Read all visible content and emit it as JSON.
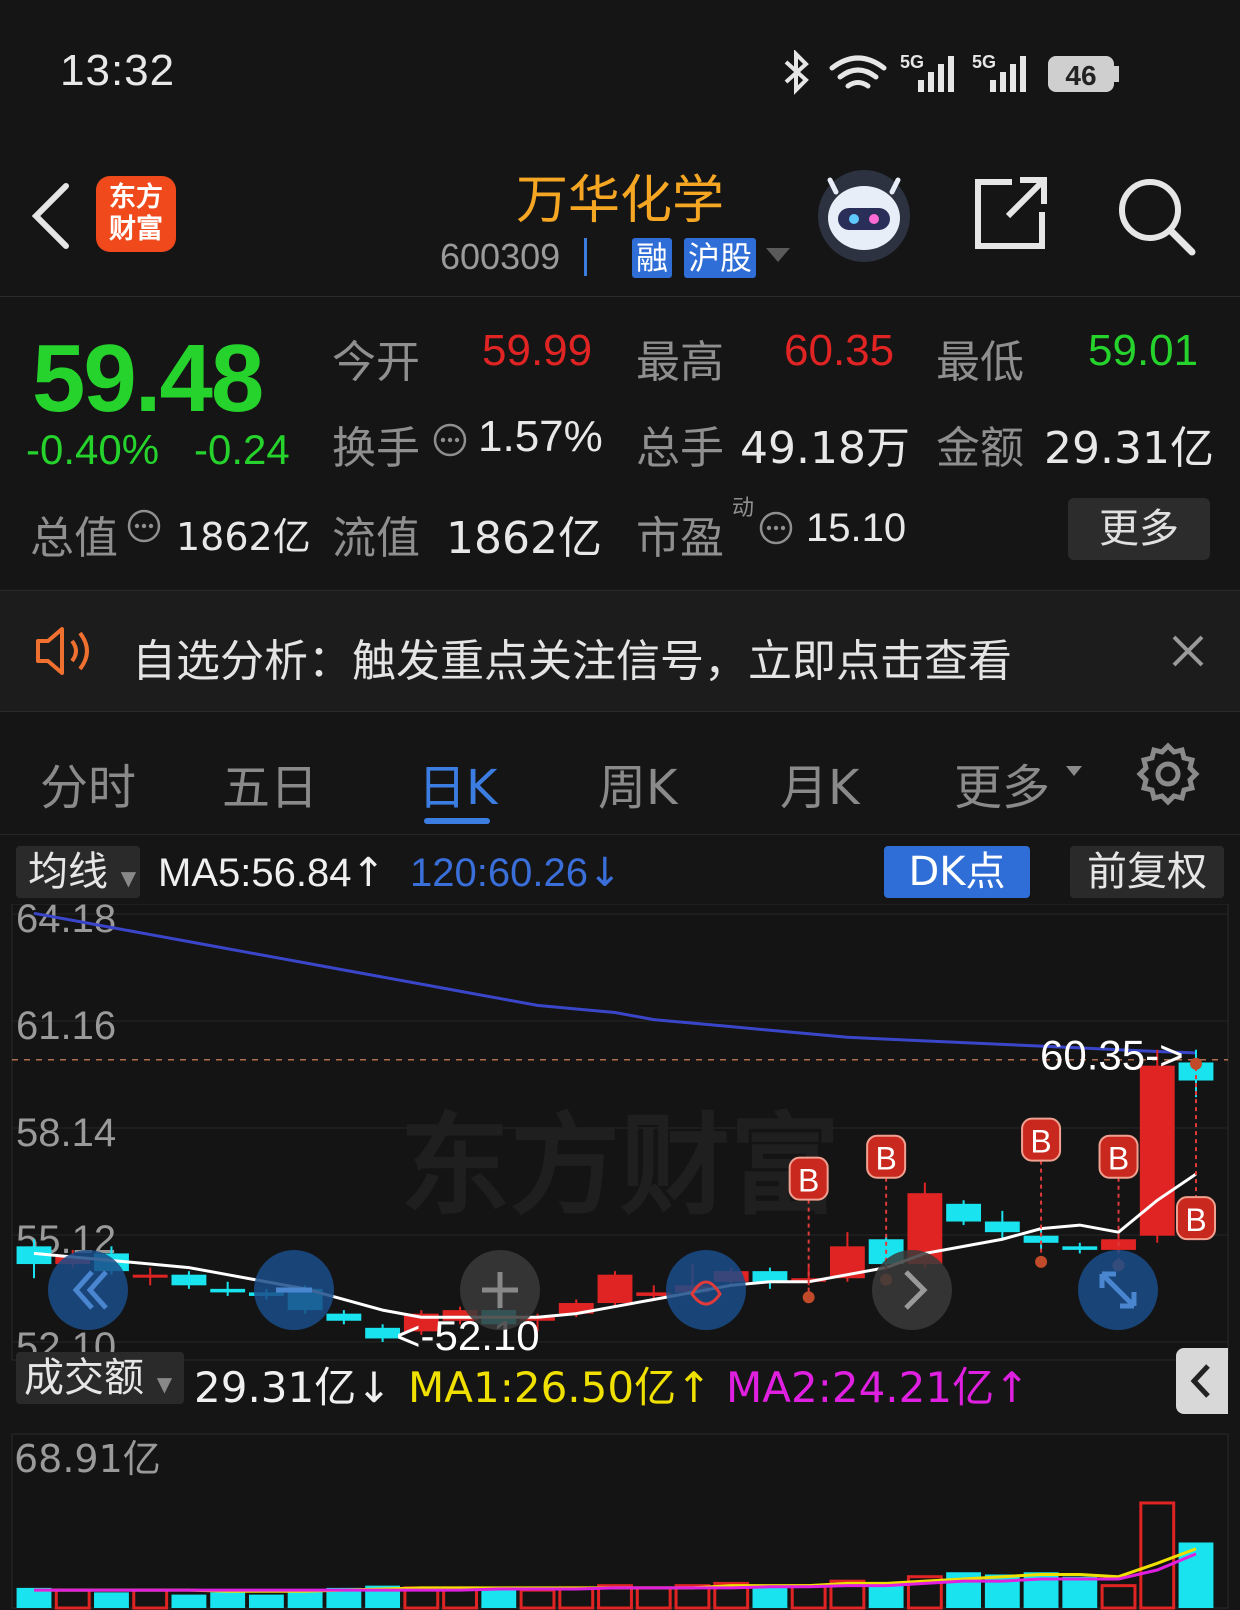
{
  "status": {
    "time": "13:32",
    "battery": "46",
    "net1": "5G",
    "net2": "5G"
  },
  "header": {
    "logo_line1": "东方",
    "logo_line2": "财富",
    "stock_name": "万华化学",
    "stock_code": "600309",
    "tag_rong": "融",
    "tag_market": "沪股"
  },
  "quote": {
    "price": "59.48",
    "change_pct": "-0.40%",
    "change_abs": "-0.24",
    "open_label": "今开",
    "open": "59.99",
    "high_label": "最高",
    "high": "60.35",
    "low_label": "最低",
    "low": "59.01",
    "turnover_label": "换手",
    "turnover": "1.57%",
    "volume_label": "总手",
    "volume": "49.18万",
    "amount_label": "金额",
    "amount": "29.31亿",
    "mktcap_label": "总值",
    "mktcap": "1862亿",
    "float_label": "流值",
    "float_cap": "1862亿",
    "pe_label": "市盈",
    "pe_sup": "动",
    "pe": "15.10",
    "more_label": "更多"
  },
  "notice": {
    "text": "自选分析：触发重点关注信号，立即点击查看"
  },
  "tabs": [
    {
      "label": "分时"
    },
    {
      "label": "五日"
    },
    {
      "label": "日K"
    },
    {
      "label": "周K"
    },
    {
      "label": "月K"
    },
    {
      "label": "更多"
    }
  ],
  "chart_controls": {
    "ma_select": "均线",
    "ma5": "MA5:56.84",
    "ma5_arrow": "↑",
    "ma120": "120:60.26",
    "ma120_arrow": "↓",
    "dk_label": "DK点",
    "adjust_label": "前复权"
  },
  "volume_controls": {
    "select": "成交额",
    "value": "29.31亿",
    "value_arrow": "↓",
    "ma1": "MA1:26.50亿",
    "ma1_arrow": "↑",
    "ma2": "MA2:24.21亿",
    "ma2_arrow": "↑",
    "ymax_label": "68.91亿"
  },
  "watermark": "东方财富",
  "colors": {
    "up": "#e02424",
    "down": "#19e3ee",
    "accent": "#3b7de0",
    "ma5": "#ffffff",
    "ma120": "#3a46c9",
    "vol_ma1": "#f0e000",
    "vol_ma2": "#e020e0"
  },
  "chart_data": {
    "type": "candlestick",
    "y_ticks": [
      64.18,
      61.16,
      58.14,
      55.12,
      52.1
    ],
    "ylim": [
      52.1,
      64.18
    ],
    "high_marker": "60.35->",
    "low_marker": "<-52.10",
    "signal_label": "B",
    "candles": [
      {
        "o": 54.8,
        "c": 54.3,
        "h": 55.0,
        "l": 53.9
      },
      {
        "o": 54.3,
        "c": 54.5,
        "h": 54.7,
        "l": 54.2
      },
      {
        "o": 54.6,
        "c": 54.1,
        "h": 54.8,
        "l": 54.0
      },
      {
        "o": 54.0,
        "c": 54.0,
        "h": 54.2,
        "l": 53.7
      },
      {
        "o": 54.0,
        "c": 53.7,
        "h": 54.1,
        "l": 53.6
      },
      {
        "o": 53.6,
        "c": 53.5,
        "h": 53.8,
        "l": 53.4
      },
      {
        "o": 53.5,
        "c": 53.4,
        "h": 53.6,
        "l": 53.3
      },
      {
        "o": 53.6,
        "c": 53.0,
        "h": 53.7,
        "l": 52.9
      },
      {
        "o": 52.9,
        "c": 52.7,
        "h": 53.0,
        "l": 52.6
      },
      {
        "o": 52.5,
        "c": 52.2,
        "h": 52.6,
        "l": 52.1
      },
      {
        "o": 52.4,
        "c": 52.9,
        "h": 53.0,
        "l": 52.3
      },
      {
        "o": 52.7,
        "c": 53.0,
        "h": 53.1,
        "l": 52.6
      },
      {
        "o": 53.0,
        "c": 52.6,
        "h": 53.2,
        "l": 52.5
      },
      {
        "o": 52.7,
        "c": 52.8,
        "h": 52.9,
        "l": 52.4
      },
      {
        "o": 52.9,
        "c": 53.2,
        "h": 53.3,
        "l": 52.8
      },
      {
        "o": 53.2,
        "c": 54.0,
        "h": 54.1,
        "l": 53.1
      },
      {
        "o": 53.4,
        "c": 53.5,
        "h": 53.7,
        "l": 53.3
      },
      {
        "o": 53.5,
        "c": 53.7,
        "h": 54.3,
        "l": 53.4
      },
      {
        "o": 53.8,
        "c": 54.1,
        "h": 54.2,
        "l": 53.7
      },
      {
        "o": 54.1,
        "c": 53.8,
        "h": 54.2,
        "l": 53.6
      },
      {
        "o": 53.8,
        "c": 53.9,
        "h": 54.2,
        "l": 53.7
      },
      {
        "o": 53.9,
        "c": 54.8,
        "h": 55.2,
        "l": 53.8
      },
      {
        "o": 55.0,
        "c": 54.3,
        "h": 55.1,
        "l": 54.2
      },
      {
        "o": 54.3,
        "c": 56.3,
        "h": 56.6,
        "l": 54.2
      },
      {
        "o": 56.0,
        "c": 55.5,
        "h": 56.1,
        "l": 55.4
      },
      {
        "o": 55.5,
        "c": 55.2,
        "h": 55.8,
        "l": 55.0
      },
      {
        "o": 55.1,
        "c": 54.9,
        "h": 55.3,
        "l": 54.7
      },
      {
        "o": 54.8,
        "c": 54.7,
        "h": 54.9,
        "l": 54.6
      },
      {
        "o": 54.7,
        "c": 55.0,
        "h": 55.1,
        "l": 54.6
      },
      {
        "o": 55.1,
        "c": 59.9,
        "h": 60.35,
        "l": 54.9
      },
      {
        "o": 59.99,
        "c": 59.48,
        "h": 60.35,
        "l": 59.01
      }
    ],
    "ma5": [
      54.6,
      54.5,
      54.4,
      54.3,
      54.2,
      54.0,
      53.8,
      53.6,
      53.3,
      53.0,
      52.8,
      52.8,
      52.8,
      52.8,
      52.9,
      53.1,
      53.3,
      53.5,
      53.7,
      53.8,
      53.8,
      54.0,
      54.2,
      54.6,
      54.8,
      55.0,
      55.3,
      55.4,
      55.2,
      56.1,
      56.84
    ],
    "ma120": [
      64.2,
      64.0,
      63.8,
      63.6,
      63.4,
      63.2,
      63.0,
      62.8,
      62.6,
      62.4,
      62.2,
      62.0,
      61.8,
      61.6,
      61.5,
      61.4,
      61.2,
      61.1,
      61.0,
      60.9,
      60.8,
      60.7,
      60.65,
      60.6,
      60.55,
      60.5,
      60.45,
      60.4,
      60.35,
      60.3,
      60.26
    ],
    "signals": [
      20,
      22,
      26,
      28,
      30
    ],
    "volume": [
      9,
      8,
      7,
      8,
      6,
      7,
      6,
      8,
      9,
      10,
      9,
      9,
      8,
      8,
      9,
      10,
      9,
      10,
      11,
      9,
      10,
      12,
      11,
      14,
      16,
      15,
      16,
      14,
      10,
      47,
      29.31
    ],
    "vol_ma1": [
      8,
      8,
      8,
      8,
      8,
      7.5,
      7.5,
      7.5,
      8,
      8.5,
      9,
      9,
      9,
      9,
      9,
      9,
      9,
      9,
      10,
      10,
      10,
      11,
      11,
      12,
      13,
      14,
      15,
      15,
      14,
      20,
      26.5
    ],
    "vol_ma2": [
      8,
      8,
      8,
      8,
      8,
      8,
      8,
      8,
      8,
      8,
      8,
      8,
      8.5,
      8.5,
      8.5,
      9,
      9,
      9,
      9,
      9.5,
      9.5,
      10,
      10,
      11,
      12,
      12,
      13,
      13,
      13,
      17,
      24.21
    ],
    "vol_ylim": [
      0,
      68.91
    ]
  }
}
